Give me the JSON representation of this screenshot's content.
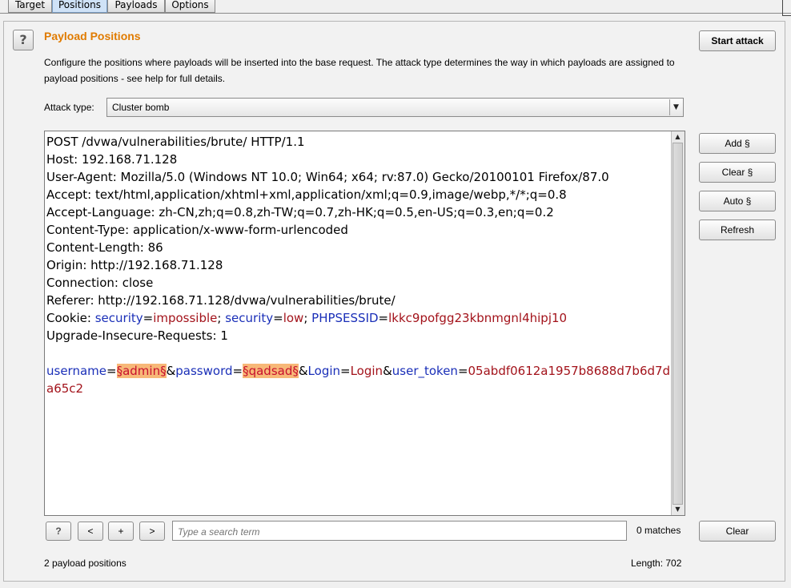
{
  "tabs": [
    {
      "label": "Target"
    },
    {
      "label": "Positions"
    },
    {
      "label": "Payloads"
    },
    {
      "label": "Options"
    }
  ],
  "header": {
    "help_label": "?",
    "title": "Payload Positions",
    "description": "Configure the positions where payloads will be inserted into the base request. The attack type determines the way in which payloads are assigned to payload positions - see help for full details.",
    "start_attack_label": "Start attack"
  },
  "attack_type": {
    "label": "Attack type:",
    "selected": "Cluster bomb"
  },
  "side_buttons": {
    "add": "Add §",
    "clear": "Clear §",
    "auto": "Auto §",
    "refresh": "Refresh"
  },
  "request": {
    "line1": "POST /dvwa/vulnerabilities/brute/ HTTP/1.1",
    "line2": "Host: 192.168.71.128",
    "line3": "User-Agent: Mozilla/5.0 (Windows NT 10.0; Win64; x64; rv:87.0) Gecko/20100101 Firefox/87.0",
    "line4": "Accept: text/html,application/xhtml+xml,application/xml;q=0.9,image/webp,*/*;q=0.8",
    "line5": "Accept-Language: zh-CN,zh;q=0.8,zh-TW;q=0.7,zh-HK;q=0.5,en-US;q=0.3,en;q=0.2",
    "line6": "Content-Type: application/x-www-form-urlencoded",
    "line7": "Content-Length: 86",
    "line8": "Origin: http://192.168.71.128",
    "line9": "Connection: close",
    "line10": "Referer: http://192.168.71.128/dvwa/vulnerabilities/brute/",
    "cookie": {
      "prefix": "Cookie: ",
      "n1": "security",
      "eq": "=",
      "v1": "impossible",
      "sep": "; ",
      "n2": "security",
      "v2": "low",
      "n3": "PHPSESSID",
      "v3": "lkkc9pofgg23kbnmgnl4hipj10"
    },
    "line12": "Upgrade-Insecure-Requests: 1",
    "body": {
      "n1": "username",
      "eq": "=",
      "m1": "§admin§",
      "amp": "&",
      "n2": "password",
      "m2": "§qadsad§",
      "n3": "Login",
      "v3": "Login",
      "n4": "user_token",
      "v4": "05abdf0612a1957b8688d7b6d7da65c2"
    }
  },
  "search": {
    "help_label": "?",
    "prev_label": "<",
    "add_label": "+",
    "next_label": ">",
    "placeholder": "Type a search term",
    "matches": "0 matches",
    "clear_label": "Clear"
  },
  "status": {
    "positions": "2 payload positions",
    "length": "Length: 702"
  }
}
